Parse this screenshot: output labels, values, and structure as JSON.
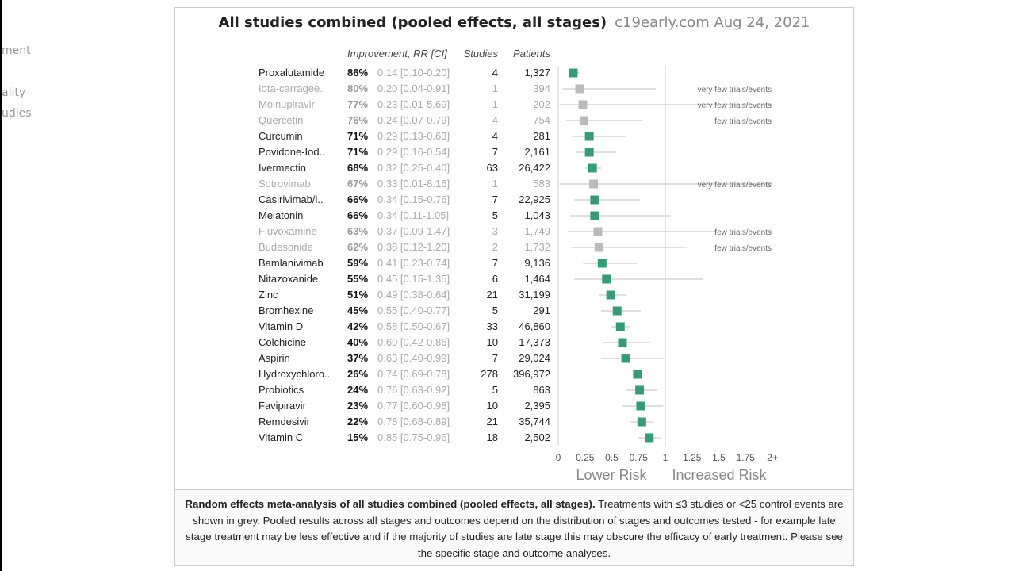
{
  "left_panel": {
    "items": [
      "ment",
      "ality",
      "udies"
    ]
  },
  "header": {
    "title": "All studies combined (pooled effects, all stages)",
    "source": "c19early.com Aug 24, 2021"
  },
  "caption": {
    "bold": "Random effects meta-analysis of all studies combined (pooled effects, all stages).",
    "text": " Treatments with ≤3 studies or <25 control events are shown in grey. Pooled results across all stages and outcomes depend on the distribution of stages and outcomes tested - for example late stage treatment may be less effective and if the majority of studies are late stage this may obscure the efficacy of early treatment. Please see the specific stage and outcome analyses."
  },
  "colors": {
    "significant": "#3a9a74",
    "grey": "#bbbbbb",
    "text": "#222222",
    "muted": "#aaaaaa"
  },
  "chart_data": {
    "type": "forest",
    "columns": [
      "Improvement, RR [CI]",
      "Studies",
      "Patients"
    ],
    "xticks": [
      "0",
      "0.25",
      "0.5",
      "0.75",
      "1",
      "1.25",
      "1.5",
      "1.75",
      "2+"
    ],
    "xlim": [
      0,
      2
    ],
    "reference_line": 1,
    "xlabel_left": "Lower Risk",
    "xlabel_right": "Increased Risk",
    "rows": [
      {
        "name": "Proxalutamide",
        "imp": "86%",
        "rr": 0.14,
        "lo": 0.1,
        "hi": 0.2,
        "ci": "0.14 [0.10-0.20]",
        "studies": "4",
        "patients": "1,327",
        "grey": false,
        "note": ""
      },
      {
        "name": "Iota-carragee..",
        "imp": "80%",
        "rr": 0.2,
        "lo": 0.04,
        "hi": 0.91,
        "ci": "0.20 [0.04-0.91]",
        "studies": "1",
        "patients": "394",
        "grey": true,
        "note": "very few trials/events"
      },
      {
        "name": "Molnupiravir",
        "imp": "77%",
        "rr": 0.23,
        "lo": 0.01,
        "hi": 5.69,
        "ci": "0.23 [0.01-5.69]",
        "studies": "1",
        "patients": "202",
        "grey": true,
        "note": "very few trials/events"
      },
      {
        "name": "Quercetin",
        "imp": "76%",
        "rr": 0.24,
        "lo": 0.07,
        "hi": 0.79,
        "ci": "0.24 [0.07-0.79]",
        "studies": "4",
        "patients": "754",
        "grey": true,
        "note": "few trials/events"
      },
      {
        "name": "Curcumin",
        "imp": "71%",
        "rr": 0.29,
        "lo": 0.13,
        "hi": 0.63,
        "ci": "0.29 [0.13-0.63]",
        "studies": "4",
        "patients": "281",
        "grey": false,
        "note": ""
      },
      {
        "name": "Povidone-Iod..",
        "imp": "71%",
        "rr": 0.29,
        "lo": 0.16,
        "hi": 0.54,
        "ci": "0.29 [0.16-0.54]",
        "studies": "7",
        "patients": "2,161",
        "grey": false,
        "note": ""
      },
      {
        "name": "Ivermectin",
        "imp": "68%",
        "rr": 0.32,
        "lo": 0.25,
        "hi": 0.4,
        "ci": "0.32 [0.25-0.40]",
        "studies": "63",
        "patients": "26,422",
        "grey": false,
        "note": ""
      },
      {
        "name": "Sotrovimab",
        "imp": "67%",
        "rr": 0.33,
        "lo": 0.01,
        "hi": 8.16,
        "ci": "0.33 [0.01-8.16]",
        "studies": "1",
        "patients": "583",
        "grey": true,
        "note": "very few trials/events"
      },
      {
        "name": "Casirivimab/i..",
        "imp": "66%",
        "rr": 0.34,
        "lo": 0.15,
        "hi": 0.76,
        "ci": "0.34 [0.15-0.76]",
        "studies": "7",
        "patients": "22,925",
        "grey": false,
        "note": ""
      },
      {
        "name": "Melatonin",
        "imp": "66%",
        "rr": 0.34,
        "lo": 0.11,
        "hi": 1.05,
        "ci": "0.34 [0.11-1.05]",
        "studies": "5",
        "patients": "1,043",
        "grey": false,
        "note": ""
      },
      {
        "name": "Fluvoxamine",
        "imp": "63%",
        "rr": 0.37,
        "lo": 0.09,
        "hi": 1.47,
        "ci": "0.37 [0.09-1.47]",
        "studies": "3",
        "patients": "1,749",
        "grey": true,
        "note": "few trials/events"
      },
      {
        "name": "Budesonide",
        "imp": "62%",
        "rr": 0.38,
        "lo": 0.12,
        "hi": 1.2,
        "ci": "0.38 [0.12-1.20]",
        "studies": "2",
        "patients": "1,732",
        "grey": true,
        "note": "few trials/events"
      },
      {
        "name": "Bamlanivimab",
        "imp": "59%",
        "rr": 0.41,
        "lo": 0.23,
        "hi": 0.74,
        "ci": "0.41 [0.23-0.74]",
        "studies": "7",
        "patients": "9,136",
        "grey": false,
        "note": ""
      },
      {
        "name": "Nitazoxanide",
        "imp": "55%",
        "rr": 0.45,
        "lo": 0.15,
        "hi": 1.35,
        "ci": "0.45 [0.15-1.35]",
        "studies": "6",
        "patients": "1,464",
        "grey": false,
        "note": ""
      },
      {
        "name": "Zinc",
        "imp": "51%",
        "rr": 0.49,
        "lo": 0.38,
        "hi": 0.64,
        "ci": "0.49 [0.38-0.64]",
        "studies": "21",
        "patients": "31,199",
        "grey": false,
        "note": ""
      },
      {
        "name": "Bromhexine",
        "imp": "45%",
        "rr": 0.55,
        "lo": 0.4,
        "hi": 0.77,
        "ci": "0.55 [0.40-0.77]",
        "studies": "5",
        "patients": "291",
        "grey": false,
        "note": ""
      },
      {
        "name": "Vitamin D",
        "imp": "42%",
        "rr": 0.58,
        "lo": 0.5,
        "hi": 0.67,
        "ci": "0.58 [0.50-0.67]",
        "studies": "33",
        "patients": "46,860",
        "grey": false,
        "note": ""
      },
      {
        "name": "Colchicine",
        "imp": "40%",
        "rr": 0.6,
        "lo": 0.42,
        "hi": 0.86,
        "ci": "0.60 [0.42-0.86]",
        "studies": "10",
        "patients": "17,373",
        "grey": false,
        "note": ""
      },
      {
        "name": "Aspirin",
        "imp": "37%",
        "rr": 0.63,
        "lo": 0.4,
        "hi": 0.99,
        "ci": "0.63 [0.40-0.99]",
        "studies": "7",
        "patients": "29,024",
        "grey": false,
        "note": ""
      },
      {
        "name": "Hydroxychloro..",
        "imp": "26%",
        "rr": 0.74,
        "lo": 0.69,
        "hi": 0.78,
        "ci": "0.74 [0.69-0.78]",
        "studies": "278",
        "patients": "396,972",
        "grey": false,
        "note": ""
      },
      {
        "name": "Probiotics",
        "imp": "24%",
        "rr": 0.76,
        "lo": 0.63,
        "hi": 0.92,
        "ci": "0.76 [0.63-0.92]",
        "studies": "5",
        "patients": "863",
        "grey": false,
        "note": ""
      },
      {
        "name": "Favipiravir",
        "imp": "23%",
        "rr": 0.77,
        "lo": 0.6,
        "hi": 0.98,
        "ci": "0.77 [0.60-0.98]",
        "studies": "10",
        "patients": "2,395",
        "grey": false,
        "note": ""
      },
      {
        "name": "Remdesivir",
        "imp": "22%",
        "rr": 0.78,
        "lo": 0.68,
        "hi": 0.89,
        "ci": "0.78 [0.68-0.89]",
        "studies": "21",
        "patients": "35,744",
        "grey": false,
        "note": ""
      },
      {
        "name": "Vitamin C",
        "imp": "15%",
        "rr": 0.85,
        "lo": 0.75,
        "hi": 0.96,
        "ci": "0.85 [0.75-0.96]",
        "studies": "18",
        "patients": "2,502",
        "grey": false,
        "note": ""
      }
    ]
  }
}
